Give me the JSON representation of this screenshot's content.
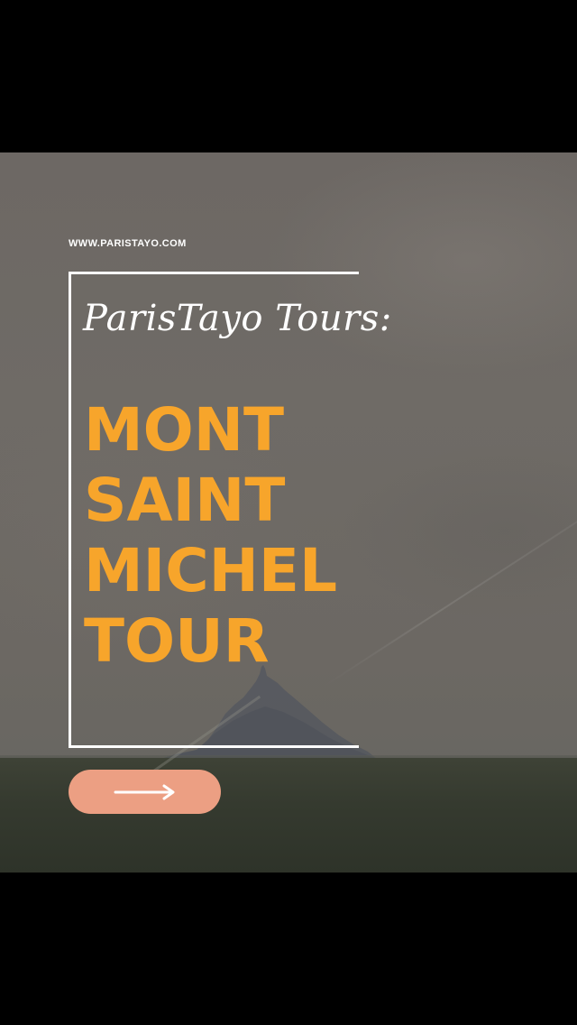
{
  "website": "WWW.PARISTAYO.COM",
  "subtitle": "ParisTayo Tours:",
  "headline": {
    "line1": "MONT",
    "line2": "SAINT",
    "line3": "MICHEL",
    "line4": "TOUR"
  },
  "button": {
    "icon": "arrow-right-icon"
  },
  "colors": {
    "headline": "#f7a52b",
    "button": "#ec9f83",
    "frame": "#ffffff",
    "letterbox": "#000000"
  }
}
